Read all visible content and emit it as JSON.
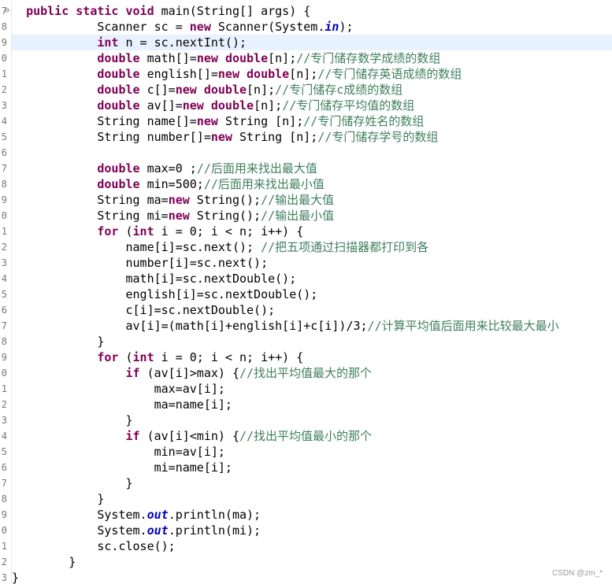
{
  "editor": {
    "current_line_index": 2,
    "lines": [
      {
        "num": "7",
        "fold": "⊖",
        "indent": "  ",
        "parts": [
          {
            "t": "public",
            "c": "kw"
          },
          {
            "t": " "
          },
          {
            "t": "static",
            "c": "kw"
          },
          {
            "t": " "
          },
          {
            "t": "void",
            "c": "kw"
          },
          {
            "t": " main(String[] args) {"
          }
        ]
      },
      {
        "num": "8",
        "indent": "            ",
        "parts": [
          {
            "t": "Scanner sc = "
          },
          {
            "t": "new",
            "c": "kw"
          },
          {
            "t": " Scanner(System."
          },
          {
            "t": "in",
            "c": "fld"
          },
          {
            "t": ");"
          }
        ]
      },
      {
        "num": "9",
        "indent": "            ",
        "parts": [
          {
            "t": "int",
            "c": "kw"
          },
          {
            "t": " n = sc.nextInt();"
          }
        ]
      },
      {
        "num": "0",
        "indent": "            ",
        "parts": [
          {
            "t": "double",
            "c": "kw"
          },
          {
            "t": " math[]="
          },
          {
            "t": "new",
            "c": "kw"
          },
          {
            "t": " "
          },
          {
            "t": "double",
            "c": "kw"
          },
          {
            "t": "[n];"
          },
          {
            "t": "//专门储存数学成绩的数组",
            "c": "cm"
          }
        ]
      },
      {
        "num": "1",
        "indent": "            ",
        "parts": [
          {
            "t": "double",
            "c": "kw"
          },
          {
            "t": " english[]="
          },
          {
            "t": "new",
            "c": "kw"
          },
          {
            "t": " "
          },
          {
            "t": "double",
            "c": "kw"
          },
          {
            "t": "[n];"
          },
          {
            "t": "//专门储存英语成绩的数组",
            "c": "cm"
          }
        ]
      },
      {
        "num": "2",
        "indent": "            ",
        "parts": [
          {
            "t": "double",
            "c": "kw"
          },
          {
            "t": " c[]="
          },
          {
            "t": "new",
            "c": "kw"
          },
          {
            "t": " "
          },
          {
            "t": "double",
            "c": "kw"
          },
          {
            "t": "[n];"
          },
          {
            "t": "//专门储存c成绩的数组",
            "c": "cm"
          }
        ]
      },
      {
        "num": "3",
        "indent": "            ",
        "parts": [
          {
            "t": "double",
            "c": "kw"
          },
          {
            "t": " av[]="
          },
          {
            "t": "new",
            "c": "kw"
          },
          {
            "t": " "
          },
          {
            "t": "double",
            "c": "kw"
          },
          {
            "t": "[n];"
          },
          {
            "t": "//专门储存平均值的数组",
            "c": "cm"
          }
        ]
      },
      {
        "num": "4",
        "indent": "            ",
        "parts": [
          {
            "t": "String name[]="
          },
          {
            "t": "new",
            "c": "kw"
          },
          {
            "t": " String [n];"
          },
          {
            "t": "//专门储存姓名的数组",
            "c": "cm"
          }
        ]
      },
      {
        "num": "5",
        "indent": "            ",
        "parts": [
          {
            "t": "String number[]="
          },
          {
            "t": "new",
            "c": "kw"
          },
          {
            "t": " String [n];"
          },
          {
            "t": "//专门储存学号的数组",
            "c": "cm"
          }
        ]
      },
      {
        "num": "6",
        "indent": "",
        "parts": []
      },
      {
        "num": "7",
        "indent": "            ",
        "parts": [
          {
            "t": "double",
            "c": "kw"
          },
          {
            "t": " max=0 ;"
          },
          {
            "t": "//后面用来找出最大值",
            "c": "cm"
          }
        ]
      },
      {
        "num": "8",
        "indent": "            ",
        "parts": [
          {
            "t": "double",
            "c": "kw"
          },
          {
            "t": " min=500;"
          },
          {
            "t": "//后面用来找出最小值",
            "c": "cm"
          }
        ]
      },
      {
        "num": "9",
        "indent": "            ",
        "parts": [
          {
            "t": "String ma="
          },
          {
            "t": "new",
            "c": "kw"
          },
          {
            "t": " String();"
          },
          {
            "t": "//输出最大值",
            "c": "cm"
          }
        ]
      },
      {
        "num": "0",
        "indent": "            ",
        "parts": [
          {
            "t": "String mi="
          },
          {
            "t": "new",
            "c": "kw"
          },
          {
            "t": " String();"
          },
          {
            "t": "//输出最小值",
            "c": "cm"
          }
        ]
      },
      {
        "num": "1",
        "indent": "            ",
        "parts": [
          {
            "t": "for",
            "c": "kw"
          },
          {
            "t": " ("
          },
          {
            "t": "int",
            "c": "kw"
          },
          {
            "t": " i = 0; i < n; i++) {"
          }
        ]
      },
      {
        "num": "2",
        "indent": "                ",
        "parts": [
          {
            "t": "name[i]=sc.next(); "
          },
          {
            "t": "//把五项通过扫描器都打印到各",
            "c": "cm"
          }
        ]
      },
      {
        "num": "3",
        "indent": "                ",
        "parts": [
          {
            "t": "number[i]=sc.next();"
          }
        ]
      },
      {
        "num": "4",
        "indent": "                ",
        "parts": [
          {
            "t": "math[i]=sc.nextDouble();"
          }
        ]
      },
      {
        "num": "5",
        "indent": "                ",
        "parts": [
          {
            "t": "english[i]=sc.nextDouble();"
          }
        ]
      },
      {
        "num": "6",
        "indent": "                ",
        "parts": [
          {
            "t": "c[i]=sc.nextDouble();"
          }
        ]
      },
      {
        "num": "7",
        "indent": "                ",
        "parts": [
          {
            "t": "av[i]=(math[i]+english[i]+c[i])/3;"
          },
          {
            "t": "//计算平均值后面用来比较最大最小",
            "c": "cm"
          }
        ]
      },
      {
        "num": "8",
        "indent": "            ",
        "parts": [
          {
            "t": "}"
          }
        ]
      },
      {
        "num": "9",
        "indent": "            ",
        "parts": [
          {
            "t": "for",
            "c": "kw"
          },
          {
            "t": " ("
          },
          {
            "t": "int",
            "c": "kw"
          },
          {
            "t": " i = 0; i < n; i++) {"
          }
        ]
      },
      {
        "num": "0",
        "indent": "                ",
        "parts": [
          {
            "t": "if",
            "c": "kw"
          },
          {
            "t": " (av[i]>max) {"
          },
          {
            "t": "//找出平均值最大的那个",
            "c": "cm"
          }
        ]
      },
      {
        "num": "1",
        "indent": "                    ",
        "parts": [
          {
            "t": "max=av[i];"
          }
        ]
      },
      {
        "num": "2",
        "indent": "                    ",
        "parts": [
          {
            "t": "ma=name[i];"
          }
        ]
      },
      {
        "num": "3",
        "indent": "                ",
        "parts": [
          {
            "t": "}"
          }
        ]
      },
      {
        "num": "4",
        "indent": "                ",
        "parts": [
          {
            "t": "if",
            "c": "kw"
          },
          {
            "t": " (av[i]<min) {"
          },
          {
            "t": "//找出平均值最小的那个",
            "c": "cm"
          }
        ]
      },
      {
        "num": "5",
        "indent": "                    ",
        "parts": [
          {
            "t": "min=av[i];"
          }
        ]
      },
      {
        "num": "6",
        "indent": "                    ",
        "parts": [
          {
            "t": "mi=name[i];"
          }
        ]
      },
      {
        "num": "7",
        "indent": "                ",
        "parts": [
          {
            "t": "}"
          }
        ]
      },
      {
        "num": "8",
        "indent": "            ",
        "parts": [
          {
            "t": "}"
          }
        ]
      },
      {
        "num": "9",
        "indent": "            ",
        "parts": [
          {
            "t": "System."
          },
          {
            "t": "out",
            "c": "fld"
          },
          {
            "t": ".println(ma);"
          }
        ]
      },
      {
        "num": "0",
        "indent": "            ",
        "parts": [
          {
            "t": "System."
          },
          {
            "t": "out",
            "c": "fld"
          },
          {
            "t": ".println(mi);"
          }
        ]
      },
      {
        "num": "1",
        "indent": "            ",
        "parts": [
          {
            "t": "sc.close();"
          }
        ]
      },
      {
        "num": "2",
        "indent": "        ",
        "parts": [
          {
            "t": "}"
          }
        ]
      },
      {
        "num": "3",
        "indent": "",
        "parts": [
          {
            "t": "}"
          }
        ]
      }
    ]
  },
  "watermark": "CSDN @zm_*",
  "colors": {
    "keyword": "#7f0055",
    "comment": "#3f7f5f",
    "static_field": "#0000c0",
    "current_line_bg": "#e8f2fe"
  }
}
